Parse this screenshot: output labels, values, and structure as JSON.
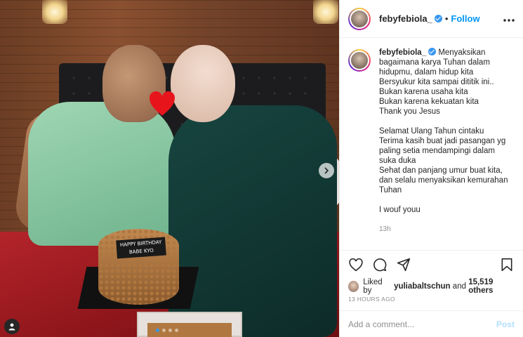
{
  "header": {
    "username": "febyfebiola_",
    "separator": "•",
    "follow_label": "Follow",
    "more_icon": "more-horizontal-icon"
  },
  "photo": {
    "cake_text": "HAPPY BIRTHDAY BABE KYO",
    "carousel_position": 1,
    "carousel_count": 4
  },
  "caption": {
    "username": "febyfebiola_",
    "lines": [
      "Menyaksikan bagaimana karya Tuhan dalam hidupmu, dalam hidup kita",
      "Bersyukur kita sampai dititik ini..",
      "Bukan karena usaha kita",
      "Bukan karena kekuatan kita",
      "Thank you Jesus",
      "",
      "Selamat Ulang Tahun cintaku",
      "Terima kasih buat jadi pasangan yg paling setia mendampingi dalam suka duka",
      "Sehat dan panjang umur buat kita, dan selalu menyaksikan kemurahan Tuhan",
      "",
      "I wouf youu"
    ],
    "time": "13h"
  },
  "likes": {
    "prefix": "Liked by",
    "user": "yuliabaltschun",
    "joiner": "and",
    "others": "15,519 others"
  },
  "posted": "13 HOURS AGO",
  "comment": {
    "placeholder": "Add a comment...",
    "post_label": "Post"
  },
  "colors": {
    "accent": "#0095f6",
    "verified": "#3897f0",
    "muted": "#8e8e8e",
    "heart": "#e8141c"
  }
}
